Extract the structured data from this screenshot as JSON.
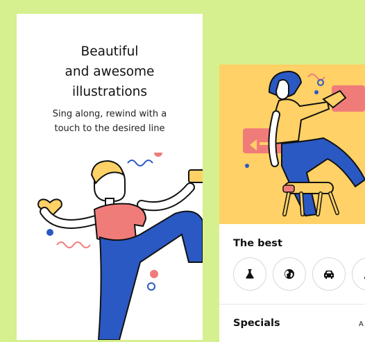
{
  "onboarding": {
    "title_lines": [
      "Beautiful",
      "and awesome",
      "illustrations"
    ],
    "subtitle_lines": [
      "Sing along, rewind with a",
      "touch to the desired line"
    ]
  },
  "home": {
    "best_title": "The best",
    "categories": [
      {
        "icon": "flask-icon"
      },
      {
        "icon": "globe-icon"
      },
      {
        "icon": "car-icon"
      },
      {
        "icon": "person-icon"
      }
    ],
    "specials_title": "Specials",
    "specials_action": "A"
  },
  "colors": {
    "background": "#d6f08f",
    "hero": "#ffd166",
    "shirt": "#f07c7a",
    "pants": "#2b59c3",
    "accent_pink": "#f07c7a",
    "accent_blue": "#2b59c3"
  }
}
